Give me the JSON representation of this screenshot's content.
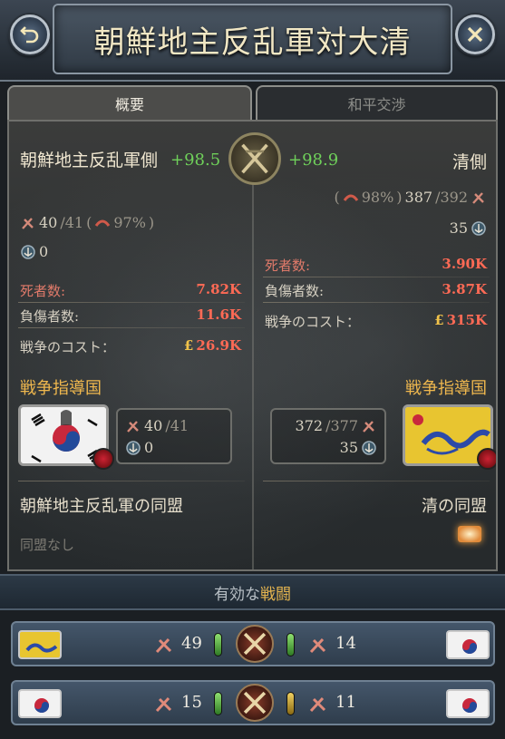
{
  "header": {
    "title": "朝鮮地主反乱軍対大清"
  },
  "tabs": [
    {
      "label": "概要",
      "active": true
    },
    {
      "label": "和平交渉",
      "active": false
    }
  ],
  "left_side": {
    "name": "朝鮮地主反乱軍側",
    "score": "+98.5",
    "troops": "40",
    "troops_max": "/41",
    "morale": "97%",
    "ships": "0",
    "dead_label": "死者数:",
    "dead_value": "7.82K",
    "wounded_label": "負傷者数:",
    "wounded_value": "11.6K",
    "cost_label": "戦争のコスト：",
    "cost_value": "26.9K",
    "leader_label": "戦争指導国",
    "leader_troops": "40",
    "leader_troops_max": "/41",
    "leader_ships": "0",
    "allies_title": "朝鮮地主反乱軍の同盟",
    "allies_none": "同盟なし"
  },
  "right_side": {
    "name": "清側",
    "score": "+98.9",
    "morale": "98%",
    "troops": "387",
    "troops_max": "/392",
    "ships": "35",
    "dead_label": "死者数:",
    "dead_value": "3.90K",
    "wounded_label": "負傷者数:",
    "wounded_value": "3.87K",
    "cost_label": "戦争のコスト：",
    "cost_value": "315K",
    "leader_label": "戦争指導国",
    "leader_troops": "372",
    "leader_troops_max": "/377",
    "leader_ships": "35",
    "allies_title": "清の同盟"
  },
  "battles": {
    "title_prefix": "有効な",
    "title_highlight": "戦闘",
    "rows": [
      {
        "left_count": "49",
        "right_count": "14"
      },
      {
        "left_count": "15",
        "right_count": "11"
      }
    ]
  },
  "colors": {
    "positive": "#6fd05a",
    "loss": "#ff6a55",
    "leader": "#f0b84e"
  },
  "icons": [
    "back-arrow-icon",
    "close-icon",
    "crossed-swords-icon",
    "soldier-icon",
    "morale-icon",
    "ship-anchor-icon",
    "pound-icon",
    "alliance-icon"
  ]
}
